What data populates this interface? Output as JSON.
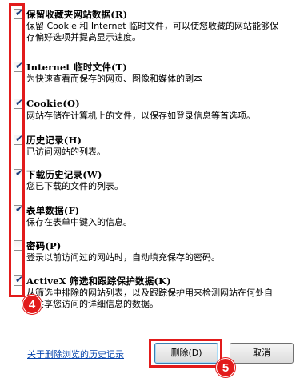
{
  "options": [
    {
      "title": "保留收藏夹网站数据(R)",
      "desc": [
        "保留 Cookie 和 Internet 临时文件，可以使您收藏的网站能够保",
        "存偏好选项并提高显示速度。"
      ],
      "checked": true
    },
    {
      "title": "Internet 临时文件(T)",
      "desc": [
        "为快速查看而保存的网页、图像和媒体的副本"
      ],
      "checked": true
    },
    {
      "title": "Cookie(O)",
      "desc": [
        "网站存储在计算机上的文件，以保存如登录信息等首选项。"
      ],
      "checked": true
    },
    {
      "title": "历史记录(H)",
      "desc": [
        "已访问网站的列表。"
      ],
      "checked": true
    },
    {
      "title": "下载历史记录(W)",
      "desc": [
        "您已下载的文件的列表。"
      ],
      "checked": true
    },
    {
      "title": "表单数据(F)",
      "desc": [
        "保存在表单中键入的信息。"
      ],
      "checked": true
    },
    {
      "title": "密码(P)",
      "desc": [
        "登录以前访问过的网站时，自动填充保存的密码。"
      ],
      "checked": false
    },
    {
      "title": "ActiveX 筛选和跟踪保护数据(K)",
      "desc": [
        "从筛选中排除的网站列表，以及跟踪保护用来检测网站在何处自",
        "动共享您访问的详细信息的数据。"
      ],
      "checked": true
    }
  ],
  "step_checkboxes": "4",
  "step_delete": "5",
  "footer": {
    "help_link": "关于删除浏览的历史记录",
    "delete_label": "删除(D)",
    "cancel_label": "取消"
  },
  "colors": {
    "annotation": "#e21b1b",
    "link": "#0645ad",
    "checkmark": "#1c3d7a"
  }
}
